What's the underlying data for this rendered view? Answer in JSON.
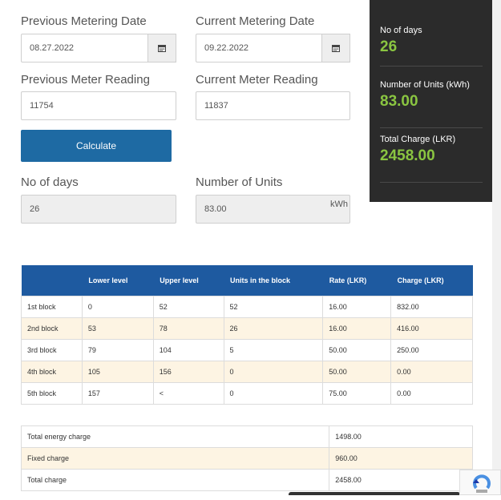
{
  "form": {
    "previous_date": {
      "label": "Previous Metering Date",
      "value": "08.27.2022"
    },
    "current_date": {
      "label": "Current Metering Date",
      "value": "09.22.2022"
    },
    "previous_reading": {
      "label": "Previous Meter Reading",
      "value": "11754"
    },
    "current_reading": {
      "label": "Current Meter Reading",
      "value": "11837"
    },
    "calculate_label": "Calculate",
    "no_of_days": {
      "label": "No of days",
      "value": "26"
    },
    "number_of_units": {
      "label": "Number of Units",
      "value": "83.00",
      "unit": "kWh"
    }
  },
  "summary": {
    "days": {
      "label": "No of days",
      "value": "26"
    },
    "units": {
      "label": "Number of Units (kWh)",
      "value": "83.00"
    },
    "charge": {
      "label": "Total Charge (LKR)",
      "value": "2458.00"
    },
    "accent_color": "#8ac541"
  },
  "blocks_table": {
    "headers": [
      "",
      "Lower level",
      "Upper level",
      "Units in the block",
      "Rate (LKR)",
      "Charge (LKR)"
    ],
    "rows": [
      [
        "1st block",
        "0",
        "52",
        "52",
        "16.00",
        "832.00"
      ],
      [
        "2nd block",
        "53",
        "78",
        "26",
        "16.00",
        "416.00"
      ],
      [
        "3rd block",
        "79",
        "104",
        "5",
        "50.00",
        "250.00"
      ],
      [
        "4th block",
        "105",
        "156",
        "0",
        "50.00",
        "0.00"
      ],
      [
        "5th block",
        "157",
        "<",
        "0",
        "75.00",
        "0.00"
      ]
    ],
    "header_color": "#1e5aa0"
  },
  "totals_table": {
    "rows": [
      [
        "Total energy charge",
        "1498.00"
      ],
      [
        "Fixed charge",
        "960.00"
      ],
      [
        "Total charge",
        "2458.00"
      ]
    ]
  }
}
